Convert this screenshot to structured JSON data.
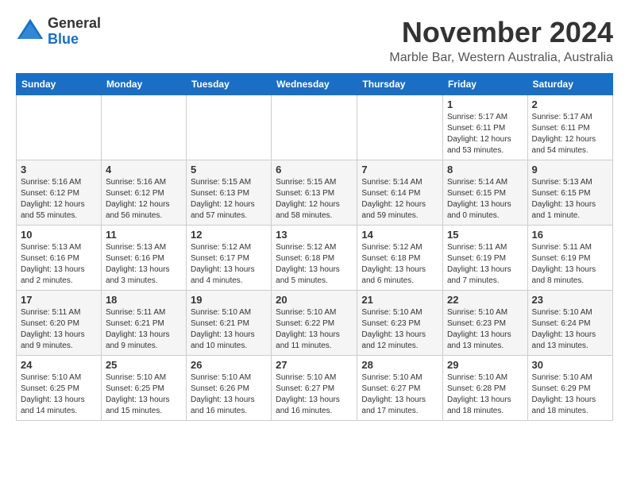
{
  "logo": {
    "general": "General",
    "blue": "Blue"
  },
  "title": {
    "month_year": "November 2024",
    "location": "Marble Bar, Western Australia, Australia"
  },
  "days_of_week": [
    "Sunday",
    "Monday",
    "Tuesday",
    "Wednesday",
    "Thursday",
    "Friday",
    "Saturday"
  ],
  "weeks": [
    [
      {
        "day": "",
        "info": ""
      },
      {
        "day": "",
        "info": ""
      },
      {
        "day": "",
        "info": ""
      },
      {
        "day": "",
        "info": ""
      },
      {
        "day": "",
        "info": ""
      },
      {
        "day": "1",
        "info": "Sunrise: 5:17 AM\nSunset: 6:11 PM\nDaylight: 12 hours\nand 53 minutes."
      },
      {
        "day": "2",
        "info": "Sunrise: 5:17 AM\nSunset: 6:11 PM\nDaylight: 12 hours\nand 54 minutes."
      }
    ],
    [
      {
        "day": "3",
        "info": "Sunrise: 5:16 AM\nSunset: 6:12 PM\nDaylight: 12 hours\nand 55 minutes."
      },
      {
        "day": "4",
        "info": "Sunrise: 5:16 AM\nSunset: 6:12 PM\nDaylight: 12 hours\nand 56 minutes."
      },
      {
        "day": "5",
        "info": "Sunrise: 5:15 AM\nSunset: 6:13 PM\nDaylight: 12 hours\nand 57 minutes."
      },
      {
        "day": "6",
        "info": "Sunrise: 5:15 AM\nSunset: 6:13 PM\nDaylight: 12 hours\nand 58 minutes."
      },
      {
        "day": "7",
        "info": "Sunrise: 5:14 AM\nSunset: 6:14 PM\nDaylight: 12 hours\nand 59 minutes."
      },
      {
        "day": "8",
        "info": "Sunrise: 5:14 AM\nSunset: 6:15 PM\nDaylight: 13 hours\nand 0 minutes."
      },
      {
        "day": "9",
        "info": "Sunrise: 5:13 AM\nSunset: 6:15 PM\nDaylight: 13 hours\nand 1 minute."
      }
    ],
    [
      {
        "day": "10",
        "info": "Sunrise: 5:13 AM\nSunset: 6:16 PM\nDaylight: 13 hours\nand 2 minutes."
      },
      {
        "day": "11",
        "info": "Sunrise: 5:13 AM\nSunset: 6:16 PM\nDaylight: 13 hours\nand 3 minutes."
      },
      {
        "day": "12",
        "info": "Sunrise: 5:12 AM\nSunset: 6:17 PM\nDaylight: 13 hours\nand 4 minutes."
      },
      {
        "day": "13",
        "info": "Sunrise: 5:12 AM\nSunset: 6:18 PM\nDaylight: 13 hours\nand 5 minutes."
      },
      {
        "day": "14",
        "info": "Sunrise: 5:12 AM\nSunset: 6:18 PM\nDaylight: 13 hours\nand 6 minutes."
      },
      {
        "day": "15",
        "info": "Sunrise: 5:11 AM\nSunset: 6:19 PM\nDaylight: 13 hours\nand 7 minutes."
      },
      {
        "day": "16",
        "info": "Sunrise: 5:11 AM\nSunset: 6:19 PM\nDaylight: 13 hours\nand 8 minutes."
      }
    ],
    [
      {
        "day": "17",
        "info": "Sunrise: 5:11 AM\nSunset: 6:20 PM\nDaylight: 13 hours\nand 9 minutes."
      },
      {
        "day": "18",
        "info": "Sunrise: 5:11 AM\nSunset: 6:21 PM\nDaylight: 13 hours\nand 9 minutes."
      },
      {
        "day": "19",
        "info": "Sunrise: 5:10 AM\nSunset: 6:21 PM\nDaylight: 13 hours\nand 10 minutes."
      },
      {
        "day": "20",
        "info": "Sunrise: 5:10 AM\nSunset: 6:22 PM\nDaylight: 13 hours\nand 11 minutes."
      },
      {
        "day": "21",
        "info": "Sunrise: 5:10 AM\nSunset: 6:23 PM\nDaylight: 13 hours\nand 12 minutes."
      },
      {
        "day": "22",
        "info": "Sunrise: 5:10 AM\nSunset: 6:23 PM\nDaylight: 13 hours\nand 13 minutes."
      },
      {
        "day": "23",
        "info": "Sunrise: 5:10 AM\nSunset: 6:24 PM\nDaylight: 13 hours\nand 13 minutes."
      }
    ],
    [
      {
        "day": "24",
        "info": "Sunrise: 5:10 AM\nSunset: 6:25 PM\nDaylight: 13 hours\nand 14 minutes."
      },
      {
        "day": "25",
        "info": "Sunrise: 5:10 AM\nSunset: 6:25 PM\nDaylight: 13 hours\nand 15 minutes."
      },
      {
        "day": "26",
        "info": "Sunrise: 5:10 AM\nSunset: 6:26 PM\nDaylight: 13 hours\nand 16 minutes."
      },
      {
        "day": "27",
        "info": "Sunrise: 5:10 AM\nSunset: 6:27 PM\nDaylight: 13 hours\nand 16 minutes."
      },
      {
        "day": "28",
        "info": "Sunrise: 5:10 AM\nSunset: 6:27 PM\nDaylight: 13 hours\nand 17 minutes."
      },
      {
        "day": "29",
        "info": "Sunrise: 5:10 AM\nSunset: 6:28 PM\nDaylight: 13 hours\nand 18 minutes."
      },
      {
        "day": "30",
        "info": "Sunrise: 5:10 AM\nSunset: 6:29 PM\nDaylight: 13 hours\nand 18 minutes."
      }
    ]
  ]
}
